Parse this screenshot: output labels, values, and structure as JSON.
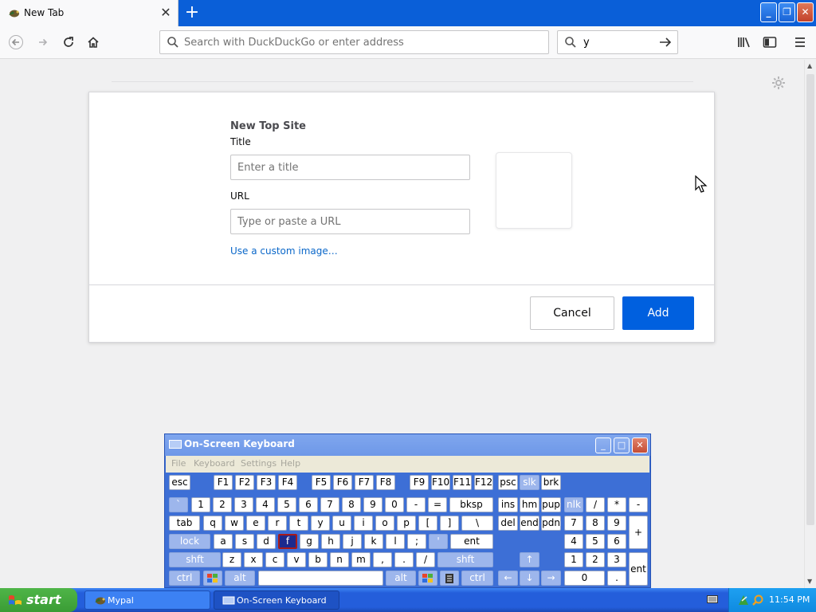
{
  "browser": {
    "tab": {
      "title": "New Tab",
      "close_glyph": "✕"
    },
    "new_tab_glyph": "+",
    "window_controls": {
      "min": "_",
      "max": "❐",
      "close": "✕"
    },
    "nav": {
      "back_icon": "arrow-left-icon",
      "forward_icon": "arrow-right-icon",
      "reload_icon": "reload-icon",
      "home_icon": "home-icon"
    },
    "urlbar": {
      "placeholder": "Search with DuckDuckGo or enter address",
      "value": ""
    },
    "searchbar": {
      "value": "y"
    }
  },
  "dialog": {
    "heading": "New Top Site",
    "title_label": "Title",
    "title_placeholder": "Enter a title",
    "url_label": "URL",
    "url_placeholder": "Type or paste a URL",
    "custom_image_link": "Use a custom image…",
    "cancel_label": "Cancel",
    "add_label": "Add",
    "add_color": "#0060df"
  },
  "osk": {
    "title": "On-Screen Keyboard",
    "menu": [
      "File",
      "Keyboard",
      "Settings",
      "Help"
    ],
    "keys": {
      "esc": "esc",
      "f": [
        "F1",
        "F2",
        "F3",
        "F4",
        "F5",
        "F6",
        "F7",
        "F8",
        "F9",
        "F10",
        "F11",
        "F12"
      ],
      "psc": "psc",
      "slk": "slk",
      "brk": "brk",
      "row1": [
        "`",
        "1",
        "2",
        "3",
        "4",
        "5",
        "6",
        "7",
        "8",
        "9",
        "0",
        "-",
        "="
      ],
      "bksp": "bksp",
      "ins": "ins",
      "hm": "hm",
      "pup": "pup",
      "nlk": "nlk",
      "div": "/",
      "mul": "*",
      "sub": "-",
      "tab": "tab",
      "row2": [
        "q",
        "w",
        "e",
        "r",
        "t",
        "y",
        "u",
        "i",
        "o",
        "p",
        "[",
        "]",
        "\\"
      ],
      "del": "del",
      "end": "end",
      "pdn": "pdn",
      "n7": "7",
      "n8": "8",
      "n9": "9",
      "add": "+",
      "lock": "lock",
      "row3": [
        "a",
        "s",
        "d",
        "f",
        "g",
        "h",
        "j",
        "k",
        "l",
        ";",
        "'"
      ],
      "ent": "ent",
      "n4": "4",
      "n5": "5",
      "n6": "6",
      "shft": "shft",
      "row4": [
        "z",
        "x",
        "c",
        "v",
        "b",
        "n",
        "m",
        ",",
        ".",
        "/"
      ],
      "n1": "1",
      "n2": "2",
      "n3": "3",
      "nent": "ent",
      "ctrl": "ctrl",
      "alt": "alt",
      "n0": "0",
      "ndot": ".",
      "up": "↑",
      "left": "←",
      "down": "↓",
      "right": "→"
    },
    "selected_key": "f"
  },
  "taskbar": {
    "start": "start",
    "tasks": [
      {
        "label": "Mypal"
      },
      {
        "label": "On-Screen Keyboard"
      }
    ],
    "clock": "11:54 PM"
  }
}
